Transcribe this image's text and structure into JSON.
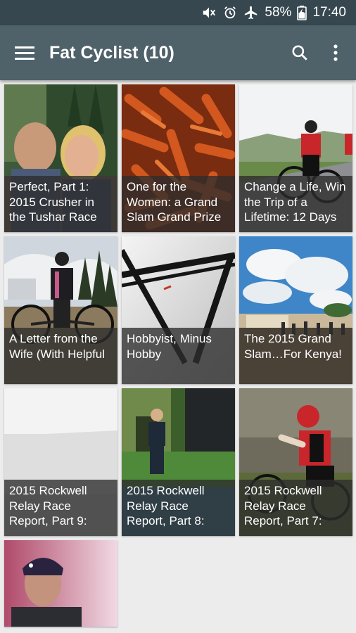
{
  "status_bar": {
    "battery_percent": "58%",
    "time": "17:40",
    "icons": [
      "mute-icon",
      "alarm-icon",
      "airplane-icon",
      "battery-charging-icon"
    ]
  },
  "app_bar": {
    "title": "Fat Cyclist (10)",
    "icons": [
      "menu-icon",
      "search-icon",
      "more-vert-icon"
    ]
  },
  "posts": [
    {
      "title": "Perfect, Part 1: 2015 Crusher in the Tushar Race"
    },
    {
      "title": "One for the Women: a Grand Slam Grand Prize"
    },
    {
      "title": "Change a Life, Win the Trip of a Lifetime: 12 Days"
    },
    {
      "title": "A Letter from the Wife (With Helpful"
    },
    {
      "title": "Hobbyist, Minus Hobby"
    },
    {
      "title": "The 2015 Grand Slam…For Kenya!"
    },
    {
      "title": "2015 Rockwell Relay Race Report, Part 9:"
    },
    {
      "title": "2015 Rockwell Relay Race Report, Part 8:"
    },
    {
      "title": "2015 Rockwell Relay Race Report, Part 7:"
    },
    {
      "title": ""
    }
  ],
  "colors": {
    "status_bar": "#36474f",
    "app_bar": "#4f6169",
    "background": "#ececec"
  }
}
